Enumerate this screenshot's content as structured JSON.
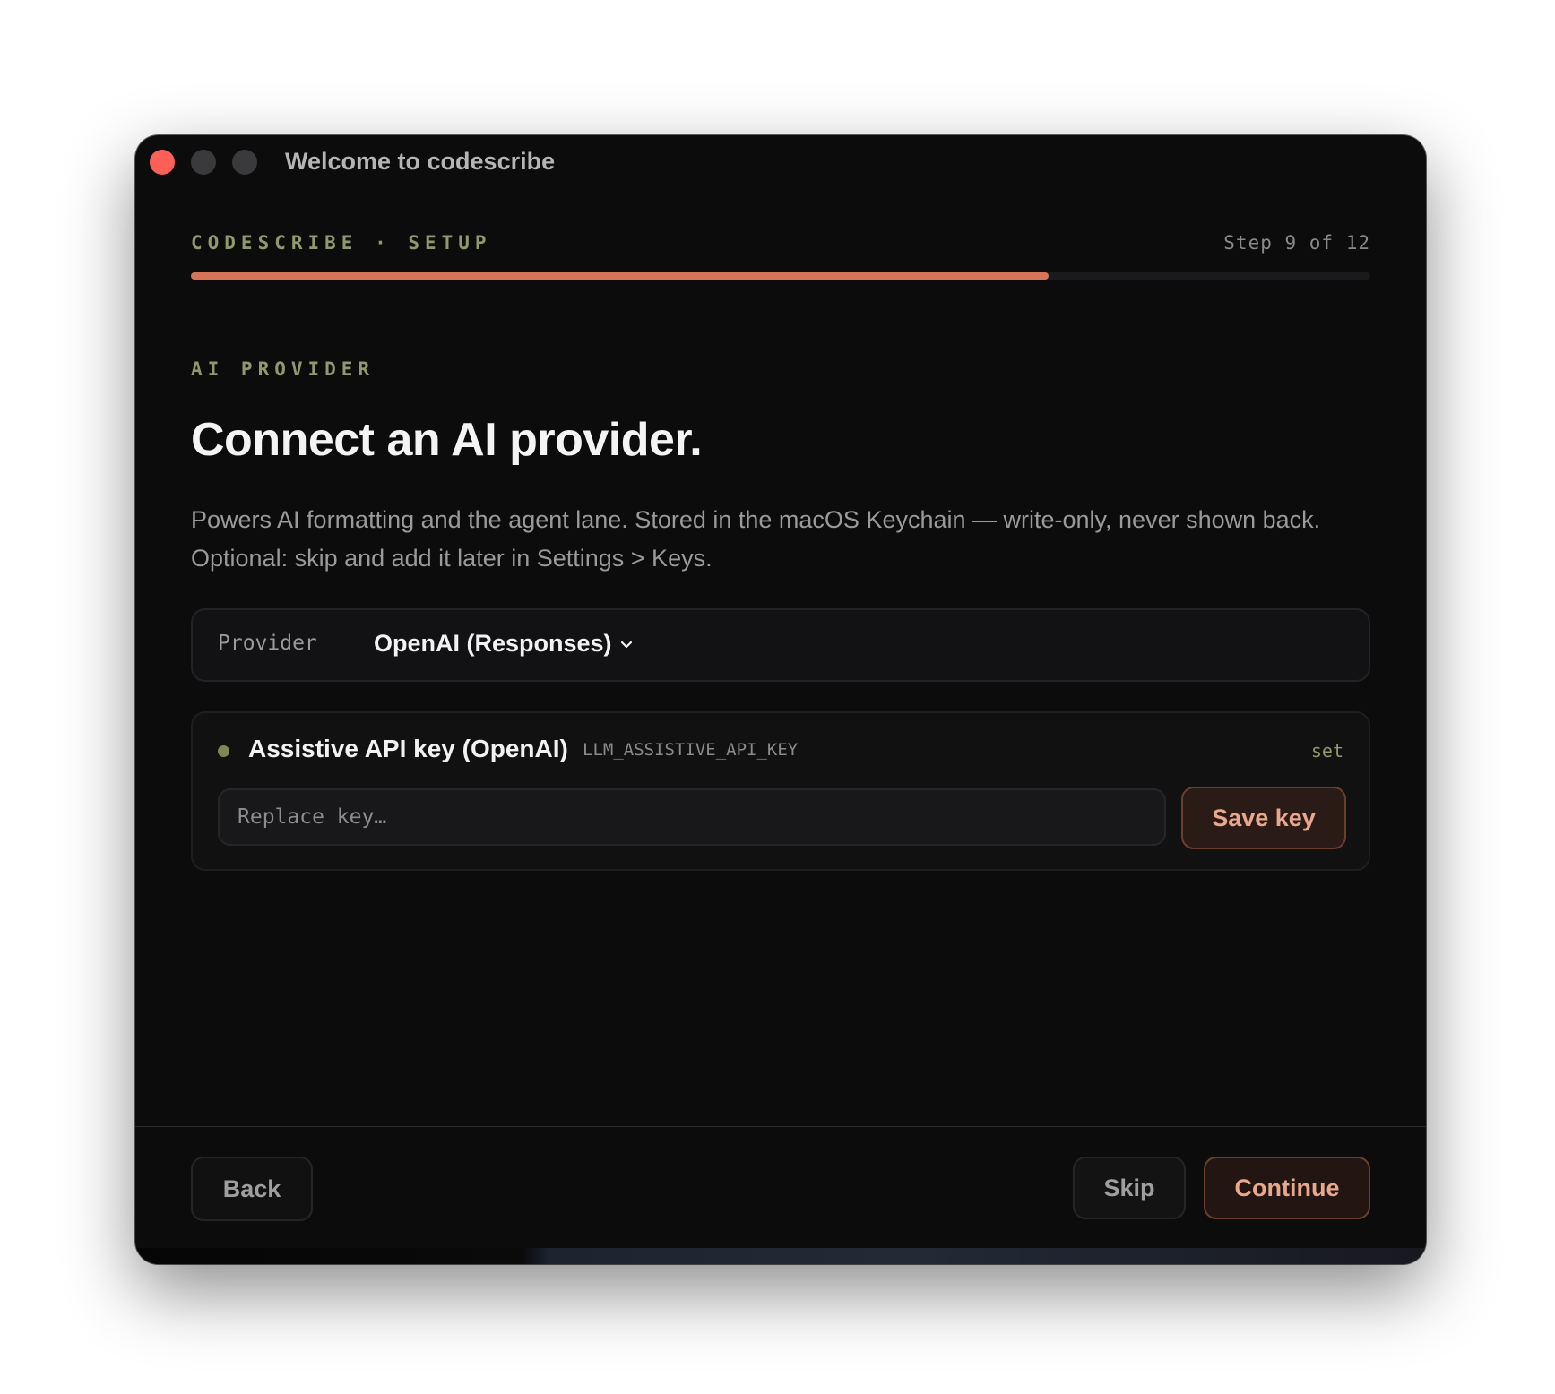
{
  "window": {
    "title": "Welcome to codescribe"
  },
  "header": {
    "brand_label": "CODESCRIBE · SETUP",
    "step_text": "Step 9 of 12",
    "progress_percent": 72.7
  },
  "main": {
    "section_label": "AI PROVIDER",
    "headline": "Connect an AI provider.",
    "description": "Powers AI formatting and the agent lane. Stored in the macOS Keychain — write-only, never shown back. Optional: skip and add it later in Settings > Keys.",
    "provider": {
      "label": "Provider",
      "selected": "OpenAI (Responses)"
    },
    "api_key": {
      "title": "Assistive API key (OpenAI)",
      "env_var": "LLM_ASSISTIVE_API_KEY",
      "status": "set",
      "placeholder": "Replace key…",
      "save_label": "Save key"
    }
  },
  "footer": {
    "back_label": "Back",
    "skip_label": "Skip",
    "continue_label": "Continue"
  },
  "colors": {
    "accent": "#d4755a",
    "label_green": "#8f9a6c",
    "close_red": "#fe5f57"
  },
  "icons": {
    "provider_dropdown": "chevron-down-icon",
    "key_status": "status-dot-icon"
  }
}
